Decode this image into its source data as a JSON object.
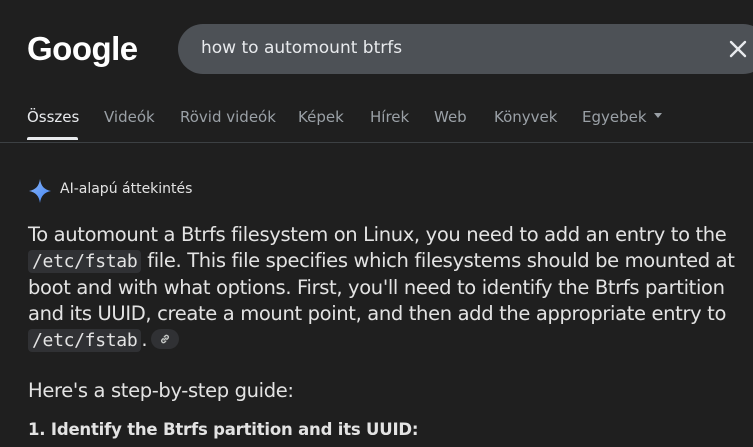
{
  "header": {
    "logo_text": "Google",
    "search": {
      "query": "how to automount btrfs"
    }
  },
  "tabs": [
    {
      "label": "Összes",
      "active": true
    },
    {
      "label": "Videók"
    },
    {
      "label": "Rövid videók"
    },
    {
      "label": "Képek"
    },
    {
      "label": "Hírek"
    },
    {
      "label": "Web"
    },
    {
      "label": "Könyvek"
    },
    {
      "label": "Egyebek"
    }
  ],
  "ai_overview": {
    "label": "AI-alapú áttekintés",
    "icon": "sparkle-icon",
    "paragraph": {
      "part1": "To automount a Btrfs filesystem on Linux, you need to add an entry to the",
      "code1": "/etc/fstab",
      "part2": " file. This file specifies which filesystems should be mounted at boot and with what options. First, you'll need to identify the Btrfs partition and its UUID, create a mount point, and then add the appropriate entry to ",
      "code2": "/etc/fstab",
      "part3": "."
    },
    "guide_intro": "Here's a step-by-step guide:",
    "step1": "1. Identify the Btrfs partition and its UUID:"
  },
  "colors": {
    "background": "#1f1f1f",
    "search_box": "#4d5156",
    "code_bg": "#303134",
    "sparkle": "#a8c7fa"
  }
}
